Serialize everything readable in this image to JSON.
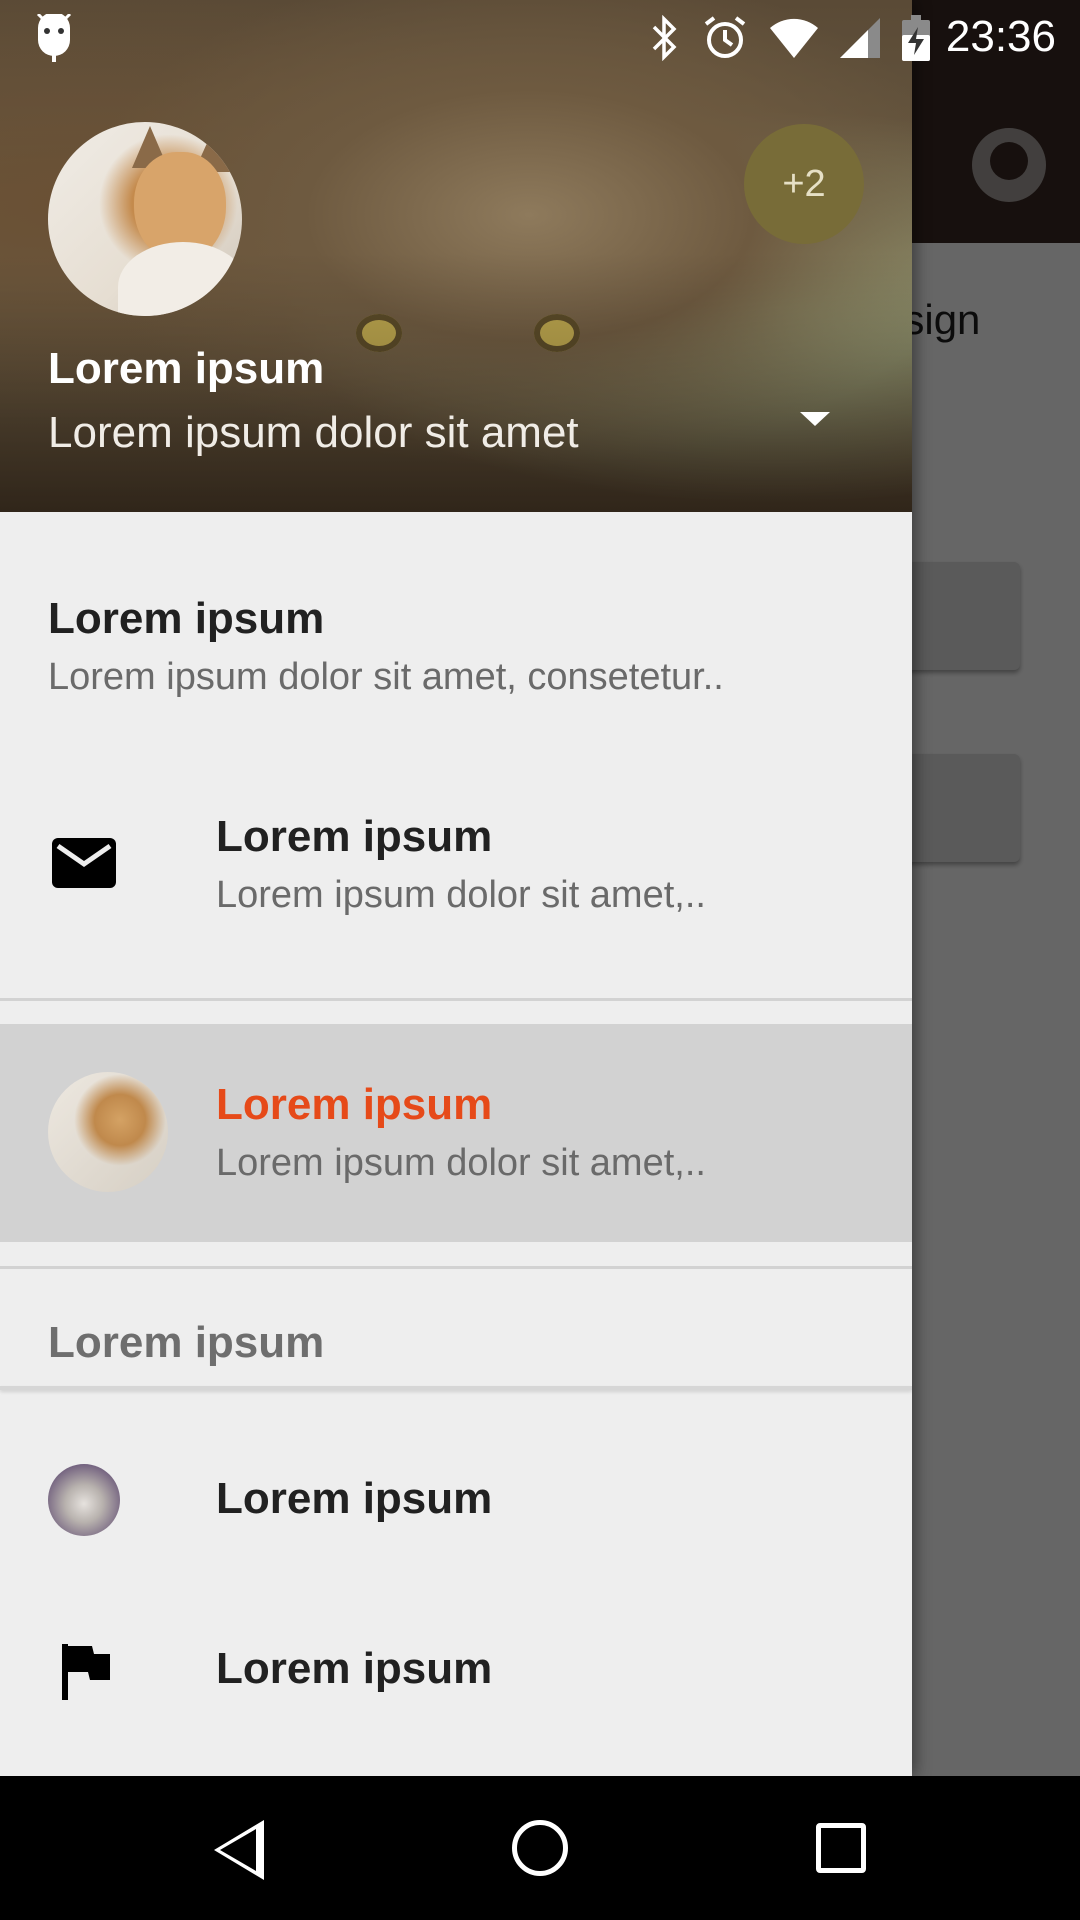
{
  "status_bar": {
    "time": "23:36"
  },
  "background_app": {
    "partial_text": "esign"
  },
  "drawer": {
    "header": {
      "profile_name": "Lorem ipsum",
      "profile_email": "Lorem ipsum dolor sit amet",
      "more_profiles_badge": "+2"
    },
    "items": [
      {
        "title": "Lorem ipsum",
        "subtitle": "Lorem ipsum dolor sit amet, consetetur..",
        "icon": "none"
      },
      {
        "title": "Lorem ipsum",
        "subtitle": "Lorem ipsum dolor sit amet,..",
        "icon": "mail-icon"
      },
      {
        "title": "Lorem ipsum",
        "subtitle": "Lorem ipsum dolor sit amet,..",
        "icon": "cat-avatar",
        "selected": true
      }
    ],
    "section_header": "Lorem ipsum",
    "section_items": [
      {
        "title": "Lorem ipsum",
        "icon": "cat-avatar-small"
      },
      {
        "title": "Lorem ipsum",
        "icon": "flag-icon"
      }
    ]
  },
  "colors": {
    "accent_selected_text": "#e64a19",
    "selected_bg": "#d2d2d2",
    "drawer_bg": "#eeeeee",
    "badge_bg": "#786c38"
  }
}
